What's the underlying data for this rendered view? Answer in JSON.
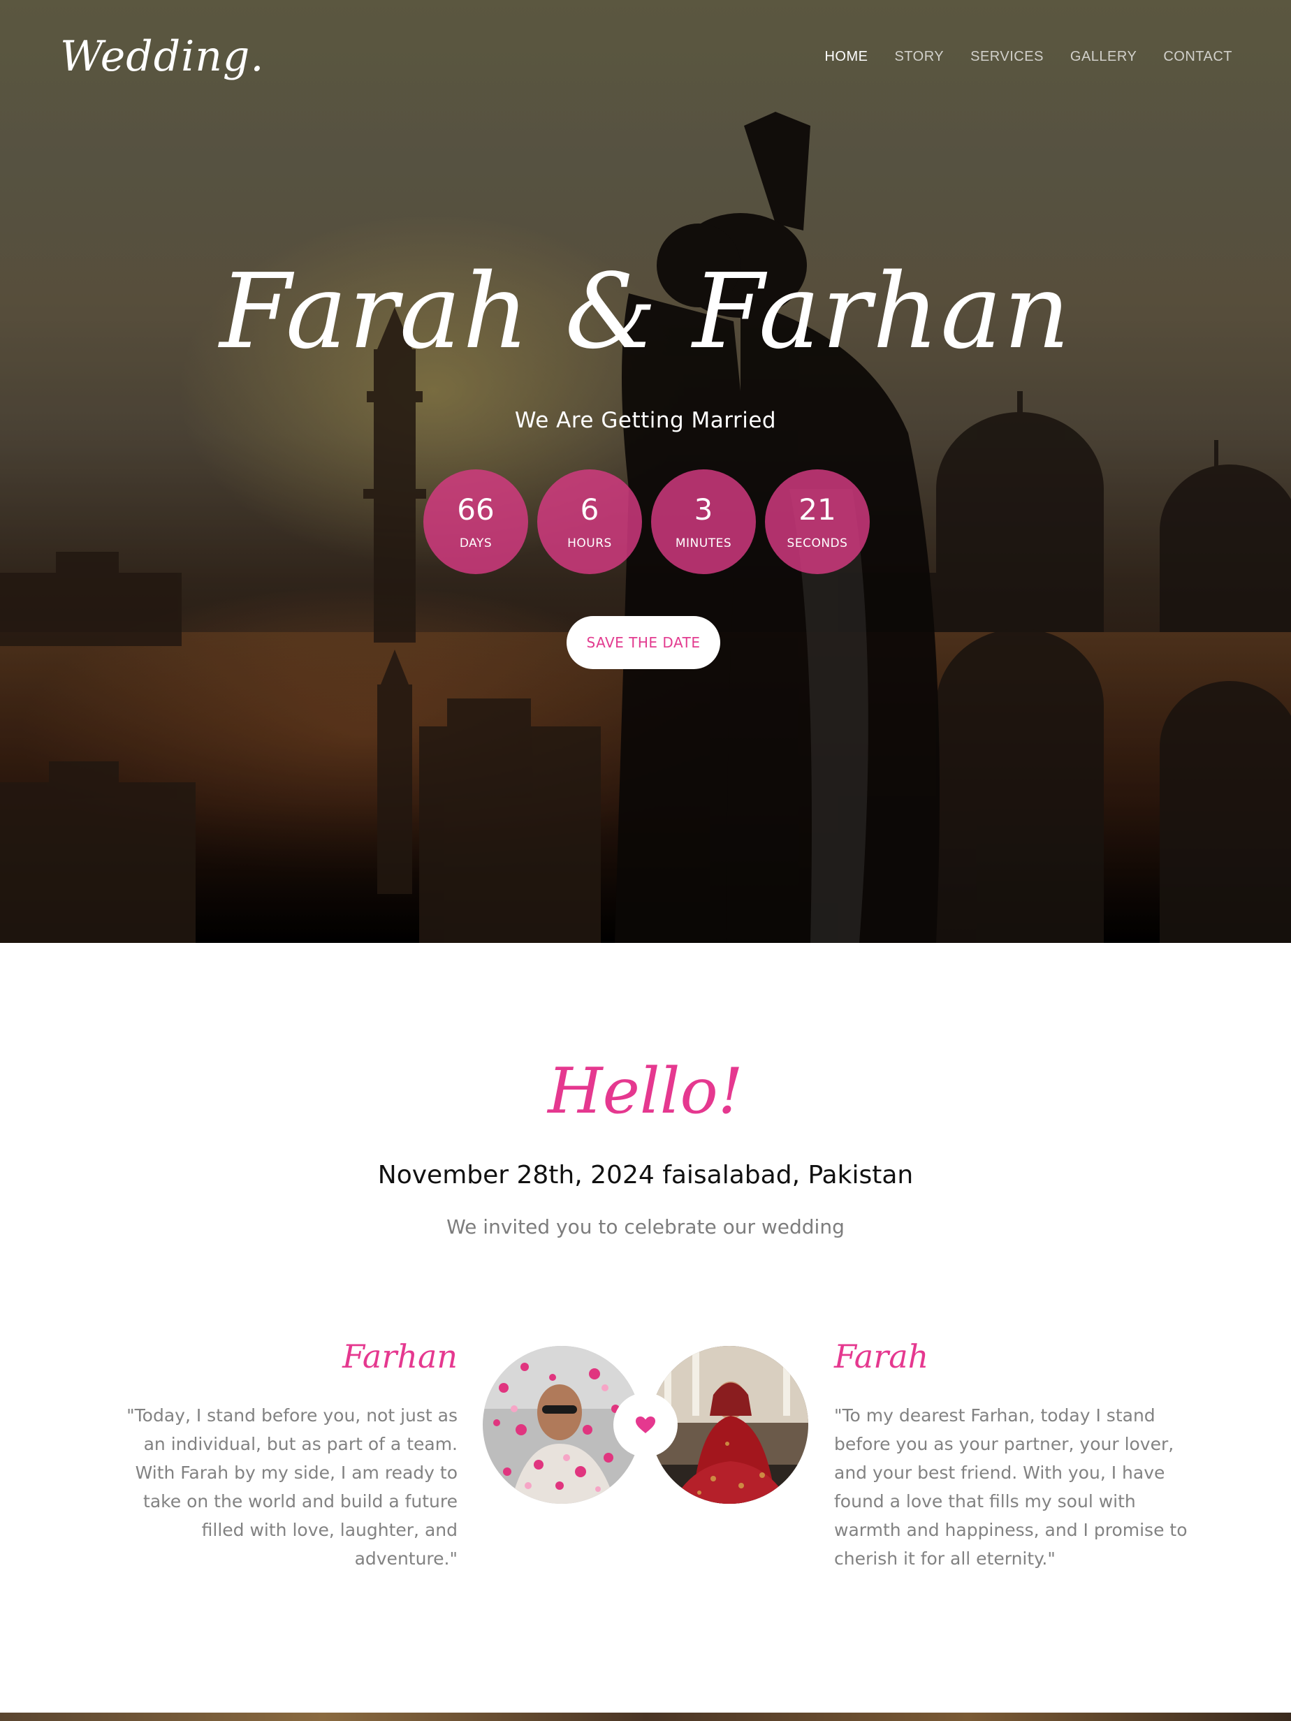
{
  "header": {
    "logo": "Wedding.",
    "nav": [
      {
        "label": "HOME",
        "active": true
      },
      {
        "label": "STORY",
        "active": false
      },
      {
        "label": "SERVICES",
        "active": false
      },
      {
        "label": "GALLERY",
        "active": false
      },
      {
        "label": "CONTACT",
        "active": false
      }
    ]
  },
  "hero": {
    "title": "Farah & Farhan",
    "subtitle": "We Are Getting Married",
    "countdown": [
      {
        "value": "66",
        "label": "DAYS"
      },
      {
        "value": "6",
        "label": "HOURS"
      },
      {
        "value": "3",
        "label": "MINUTES"
      },
      {
        "value": "21",
        "label": "SECONDS"
      }
    ],
    "cta_label": "SAVE THE DATE"
  },
  "hello": {
    "title": "Hello!",
    "event_line": "November 28th, 2024 faisalabad, Pakistan",
    "invite_line": "We invited you to celebrate our wedding"
  },
  "couple": {
    "groom": {
      "name": "Farhan",
      "quote": "\"Today, I stand before you, not just as an individual, but as part of a team. With Farah by my side, I am ready to take on the world and build a future filled with love, laughter, and adventure.\""
    },
    "bride": {
      "name": "Farah",
      "quote": "\"To my dearest Farhan, today I stand before you as your partner, your lover, and your best friend. With you, I have found a love that fills my soul with warmth and happiness, and I promise to cherish it for all eternity.\""
    },
    "heart_icon": "heart-icon"
  },
  "colors": {
    "accent": "#e5388f",
    "countdown_bg": "#d63b83",
    "muted_text": "#828282"
  }
}
